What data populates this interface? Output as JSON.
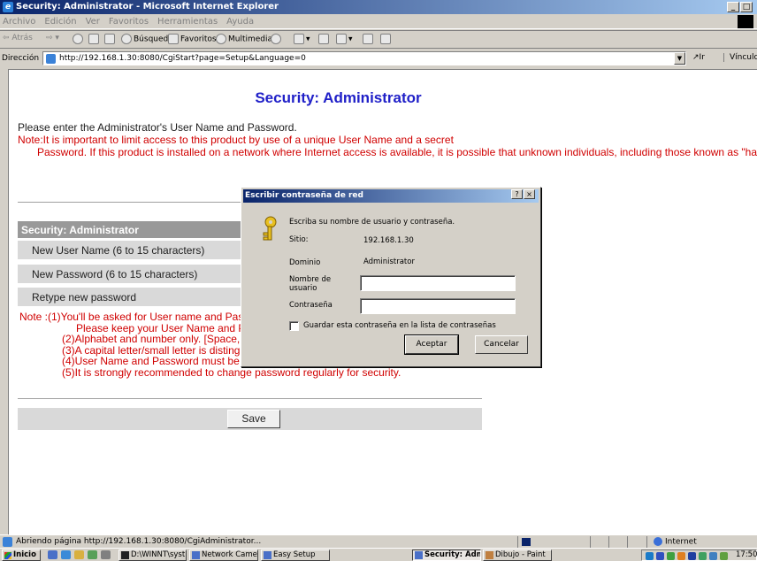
{
  "window": {
    "title": "Security: Administrator - Microsoft Internet Explorer",
    "controls": [
      "_",
      "□"
    ]
  },
  "menu": [
    "Archivo",
    "Edición",
    "Ver",
    "Favoritos",
    "Herramientas",
    "Ayuda"
  ],
  "toolbar": {
    "back": "⇦ Atrás",
    "search": "Búsqueda",
    "favorites": "Favoritos",
    "multimedia": "Multimedia"
  },
  "address": {
    "label": "Dirección",
    "url": "http://192.168.1.30:8080/CgiStart?page=Setup&Language=0",
    "go": "Ir",
    "links": "Vínculos"
  },
  "page": {
    "title": "Security: Administrator",
    "intro": "Please enter the Administrator's User Name and Password.",
    "note_first": "Note:It is important to limit access to this product by use of a unique User Name and a secret",
    "note_rest": "Password. If this product is installed on a network where Internet access is available, it is possible that unknown individuals, including those known as \"hackers,\" could access this product. The use of a User Name and a Password known only to you will help insure that only authorized users are given access to this product.",
    "section_header": "Security: Administrator",
    "rows": [
      "New User Name (6 to 15 characters)",
      "New Password (6 to 15 characters)",
      "Retype new password"
    ],
    "notes": [
      "Note :(1)You'll be asked for User name and Password when you access the setup page next time.",
      "Please keep your User Name and Password in a safe place.",
      "(2)Alphabet and number only. [Space, symbol, and 2-byte characters not accepted.]",
      "(3)A capital letter/small letter is distinguished.",
      "(4)User Name and Password must be different from each other.",
      "(5)It is strongly recommended to change password regularly for security."
    ],
    "save_label": "Save"
  },
  "dialog": {
    "title": "Escribir contraseña de red",
    "help": "?",
    "close": "×",
    "prompt": "Escriba su nombre de usuario y contraseña.",
    "site_label": "Sitio:",
    "site_value": "192.168.1.30",
    "domain_label": "Dominio",
    "domain_value": "Administrator",
    "user_label": "Nombre de usuario",
    "password_label": "Contraseña",
    "save_checkbox": "Guardar esta contraseña en la lista de contraseñas",
    "ok": "Aceptar",
    "cancel": "Cancelar"
  },
  "status": {
    "text": "Abriendo página http://192.168.1.30:8080/CgiAdministrator...",
    "zone": "Internet"
  },
  "taskbar": {
    "start": "Inicio",
    "buttons": [
      "D:\\WINNT\\syst...",
      "Network Camera",
      "Easy Setup",
      "Security: Adm...",
      "Dibujo - Paint"
    ],
    "clock": "17:50"
  }
}
